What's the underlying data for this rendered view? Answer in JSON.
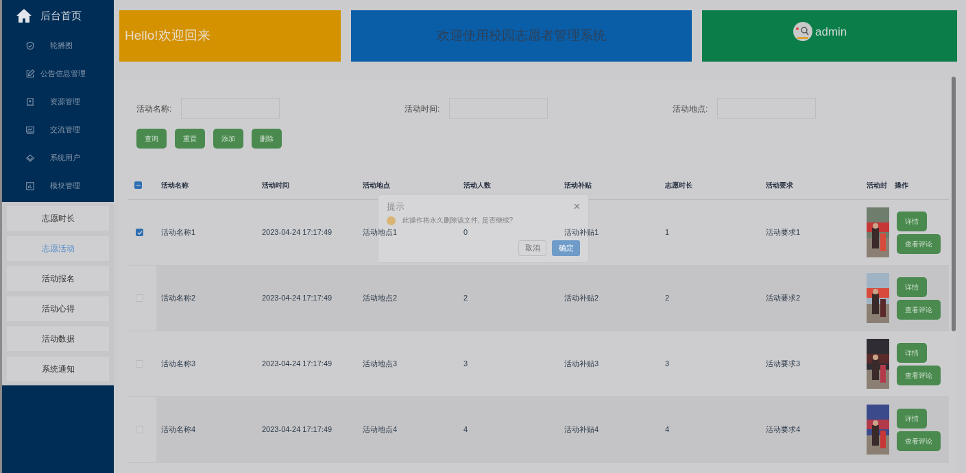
{
  "sidebar": {
    "home": "后台首页",
    "items": [
      {
        "label": "轮播图"
      },
      {
        "label": "公告信息管理"
      },
      {
        "label": "资源管理"
      },
      {
        "label": "交流管理"
      },
      {
        "label": "系统用户"
      },
      {
        "label": "模块管理"
      }
    ],
    "submenu": [
      {
        "label": "志愿时长",
        "selected": false
      },
      {
        "label": "志愿活动",
        "selected": true
      },
      {
        "label": "活动报名",
        "selected": false
      },
      {
        "label": "活动心得",
        "selected": false
      },
      {
        "label": "活动数据",
        "selected": false
      },
      {
        "label": "系统通知",
        "selected": false
      }
    ]
  },
  "header": {
    "greeting": "Hello!欢迎回来",
    "title": "欢迎使用校园志愿者管理系统",
    "user": "admin"
  },
  "filters": [
    {
      "label": "活动名称:"
    },
    {
      "label": "活动时间:"
    },
    {
      "label": "活动地点:"
    }
  ],
  "actions": [
    "查询",
    "重置",
    "添加",
    "删除"
  ],
  "table": {
    "select_all": {
      "indeterminate": true
    },
    "columns": [
      "活动名称",
      "活动时间",
      "活动地点",
      "活动人数",
      "活动补贴",
      "志愿时长",
      "活动要求",
      "活动封",
      "操作"
    ],
    "rows": [
      {
        "checked": true,
        "cells": [
          "活动名称1",
          "2023-04-24 17:17:49",
          "活动地点1",
          "0",
          "活动补贴1",
          "1",
          "活动要求1"
        ],
        "cover": {
          "kind": "picture"
        },
        "buttons": [
          "详情",
          "查看评论"
        ]
      },
      {
        "checked": false,
        "cells": [
          "活动名称2",
          "2023-04-24 17:17:49",
          "活动地点2",
          "2",
          "活动补贴2",
          "2",
          "活动要求2"
        ],
        "cover": {
          "kind": "picture"
        },
        "buttons": [
          "详情",
          "查看评论"
        ]
      },
      {
        "checked": false,
        "cells": [
          "活动名称3",
          "2023-04-24 17:17:49",
          "活动地点3",
          "3",
          "活动补贴3",
          "3",
          "活动要求3"
        ],
        "cover": {
          "kind": "picture"
        },
        "buttons": [
          "详情",
          "查看评论"
        ]
      },
      {
        "checked": false,
        "cells": [
          "活动名称4",
          "2023-04-24 17:17:49",
          "活动地点4",
          "4",
          "活动补贴4",
          "4",
          "活动要求4"
        ],
        "cover": {
          "kind": "picture"
        },
        "buttons": [
          "详情",
          "查看评论"
        ]
      }
    ]
  },
  "dialog": {
    "title": "提示",
    "close": "×",
    "message": "此操作将永久删除该文件, 是否继续?",
    "buttons": [
      "取消",
      "确定"
    ]
  }
}
